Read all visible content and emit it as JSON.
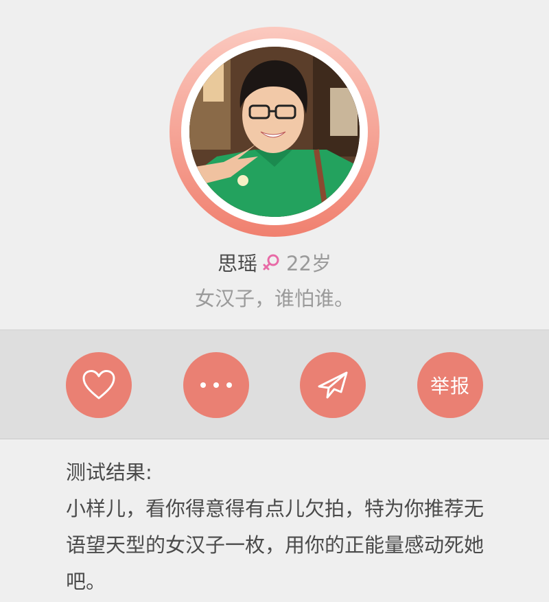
{
  "profile": {
    "name": "思瑶",
    "gender_icon": "female-symbol-icon",
    "age": "22岁",
    "motto": "女汉子，谁怕谁。"
  },
  "actions": {
    "like_icon": "heart-icon",
    "more_icon": "more-dots-icon",
    "send_icon": "send-plane-icon",
    "report_label": "举报"
  },
  "result": {
    "title": "测试结果:",
    "body": "小样儿，看你得意得有点儿欠拍，特为你推荐无语望天型的女汉子一枚，用你的正能量感动死她吧。"
  },
  "colors": {
    "accent": "#ea8073",
    "gender_pink": "#e86aa6",
    "background": "#efefef",
    "action_bar": "#dedede"
  }
}
